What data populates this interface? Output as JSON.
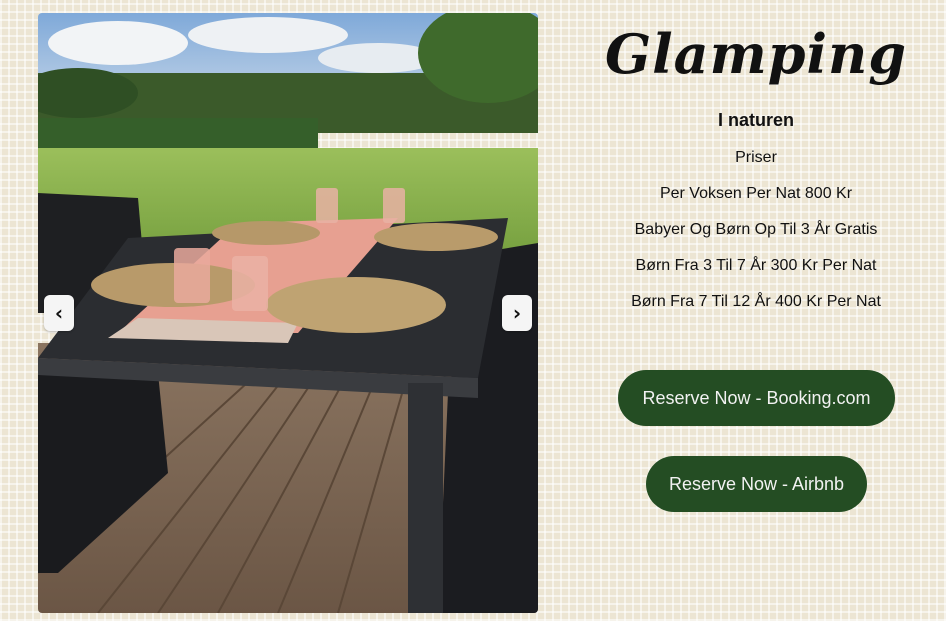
{
  "slider": {
    "image_alt": "Outdoor dining table on wooden deck overlooking a green field",
    "prev_icon": "chevron-left-icon",
    "next_icon": "chevron-right-icon",
    "prev_glyph": "‹",
    "next_glyph": "›"
  },
  "info": {
    "brand": "Glamping",
    "subtitle": "I naturen",
    "prices_label": "Priser",
    "prices": [
      "Per Voksen Per Nat 800 Kr",
      "Babyer Og Børn Op Til 3 År Gratis",
      "Børn Fra 3 Til 7 År 300 Kr Per Nat",
      "Børn Fra 7 Til 12 År 400 Kr Per Nat"
    ]
  },
  "buttons": {
    "booking": "Reserve Now - Booking.com",
    "airbnb": "Reserve Now - Airbnb"
  },
  "colors": {
    "background": "#ece5d3",
    "button": "#244d23",
    "button_text": "#f2f2f2"
  }
}
